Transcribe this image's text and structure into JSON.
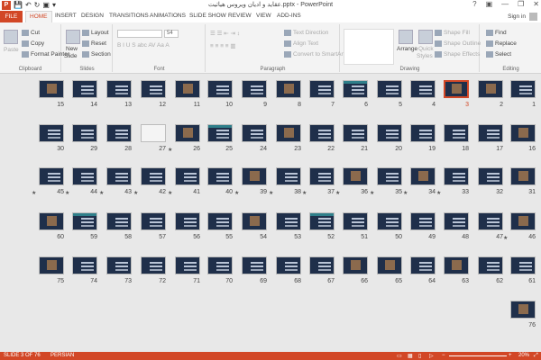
{
  "window": {
    "title": "عقاید و ادیان ویروس هیاتیت.pptx - PowerPoint",
    "help": "?",
    "ribbon_display": "▣",
    "minimize": "—",
    "restore": "❐",
    "close": "✕"
  },
  "tabs": {
    "file": "FILE",
    "home": "HOME",
    "insert": "INSERT",
    "design": "DESIGN",
    "transitions": "TRANSITIONS",
    "animations": "ANIMATIONS",
    "slideshow": "SLIDE SHOW",
    "review": "REVIEW",
    "view": "VIEW",
    "addins": "ADD-INS",
    "signin": "Sign in"
  },
  "ribbon": {
    "clipboard": {
      "paste": "Paste",
      "cut": "Cut",
      "copy": "Copy",
      "format_painter": "Format Painter",
      "label": "Clipboard"
    },
    "slides": {
      "new_slide": "New",
      "new_slide2": "Slide",
      "layout": "Layout",
      "reset": "Reset",
      "section": "Section",
      "label": "Slides"
    },
    "font": {
      "size": "54",
      "label": "Font"
    },
    "paragraph": {
      "text_direction": "Text Direction",
      "align_text": "Align Text",
      "convert": "Convert to SmartArt",
      "label": "Paragraph"
    },
    "drawing": {
      "arrange": "Arrange",
      "quick_styles": "Quick",
      "quick_styles2": "Styles",
      "shape_fill": "Shape Fill",
      "shape_outline": "Shape Outline",
      "shape_effects": "Shape Effects",
      "label": "Drawing"
    },
    "editing": {
      "find": "Find",
      "replace": "Replace",
      "select": "Select",
      "label": "Editing"
    }
  },
  "slides": [
    {
      "n": "15",
      "kind": "pic"
    },
    {
      "n": "14",
      "kind": "text"
    },
    {
      "n": "13",
      "kind": "text"
    },
    {
      "n": "12",
      "kind": "text"
    },
    {
      "n": "11",
      "kind": "pic"
    },
    {
      "n": "10",
      "kind": "text"
    },
    {
      "n": "9",
      "kind": "text"
    },
    {
      "n": "8",
      "kind": "pic"
    },
    {
      "n": "7",
      "kind": "text"
    },
    {
      "n": "6",
      "kind": "band"
    },
    {
      "n": "5",
      "kind": "text"
    },
    {
      "n": "4",
      "kind": "text"
    },
    {
      "n": "3",
      "kind": "pic"
    },
    {
      "n": "2",
      "kind": "pic"
    },
    {
      "n": "1",
      "kind": "text"
    },
    {
      "n": "30",
      "kind": "text"
    },
    {
      "n": "29",
      "kind": "text"
    },
    {
      "n": "28",
      "kind": "text"
    },
    {
      "n": "27",
      "kind": "white"
    },
    {
      "n": "26",
      "kind": "pic"
    },
    {
      "n": "25",
      "kind": "band"
    },
    {
      "n": "24",
      "kind": "text"
    },
    {
      "n": "23",
      "kind": "pic"
    },
    {
      "n": "22",
      "kind": "text"
    },
    {
      "n": "21",
      "kind": "text"
    },
    {
      "n": "20",
      "kind": "text"
    },
    {
      "n": "19",
      "kind": "text"
    },
    {
      "n": "18",
      "kind": "text"
    },
    {
      "n": "17",
      "kind": "text"
    },
    {
      "n": "16",
      "kind": "pic"
    },
    {
      "n": "45",
      "kind": "text"
    },
    {
      "n": "44",
      "kind": "text"
    },
    {
      "n": "43",
      "kind": "text"
    },
    {
      "n": "42",
      "kind": "text"
    },
    {
      "n": "41",
      "kind": "text"
    },
    {
      "n": "40",
      "kind": "text"
    },
    {
      "n": "39",
      "kind": "pic"
    },
    {
      "n": "38",
      "kind": "text"
    },
    {
      "n": "37",
      "kind": "text"
    },
    {
      "n": "36",
      "kind": "pic"
    },
    {
      "n": "35",
      "kind": "text"
    },
    {
      "n": "34",
      "kind": "pic"
    },
    {
      "n": "33",
      "kind": "text"
    },
    {
      "n": "32",
      "kind": "text"
    },
    {
      "n": "31",
      "kind": "pic"
    },
    {
      "n": "60",
      "kind": "pic"
    },
    {
      "n": "59",
      "kind": "band"
    },
    {
      "n": "58",
      "kind": "text"
    },
    {
      "n": "57",
      "kind": "text"
    },
    {
      "n": "56",
      "kind": "text"
    },
    {
      "n": "55",
      "kind": "text"
    },
    {
      "n": "54",
      "kind": "pic"
    },
    {
      "n": "53",
      "kind": "text"
    },
    {
      "n": "52",
      "kind": "band"
    },
    {
      "n": "51",
      "kind": "text"
    },
    {
      "n": "50",
      "kind": "text"
    },
    {
      "n": "49",
      "kind": "text"
    },
    {
      "n": "48",
      "kind": "text"
    },
    {
      "n": "47",
      "kind": "text"
    },
    {
      "n": "46",
      "kind": "pic"
    },
    {
      "n": "75",
      "kind": "pic"
    },
    {
      "n": "74",
      "kind": "text"
    },
    {
      "n": "73",
      "kind": "text"
    },
    {
      "n": "72",
      "kind": "text"
    },
    {
      "n": "71",
      "kind": "text"
    },
    {
      "n": "70",
      "kind": "text"
    },
    {
      "n": "69",
      "kind": "text"
    },
    {
      "n": "68",
      "kind": "text"
    },
    {
      "n": "67",
      "kind": "text"
    },
    {
      "n": "66",
      "kind": "pic"
    },
    {
      "n": "65",
      "kind": "pic"
    },
    {
      "n": "64",
      "kind": "text"
    },
    {
      "n": "63",
      "kind": "pic"
    },
    {
      "n": "62",
      "kind": "text"
    },
    {
      "n": "61",
      "kind": "text"
    },
    {
      "n": "76",
      "kind": "pic"
    }
  ],
  "selected_slide": "3",
  "starred": [
    "26",
    "45",
    "44",
    "43",
    "42",
    "41",
    "39",
    "38",
    "37",
    "36",
    "35",
    "34",
    "33",
    "46"
  ],
  "status": {
    "slide_of": "SLIDE 3 OF 76",
    "language": "PERSIAN",
    "zoom": "20%"
  },
  "colors": {
    "accent": "#d24726",
    "slide_bg": "#1f2f4a"
  }
}
